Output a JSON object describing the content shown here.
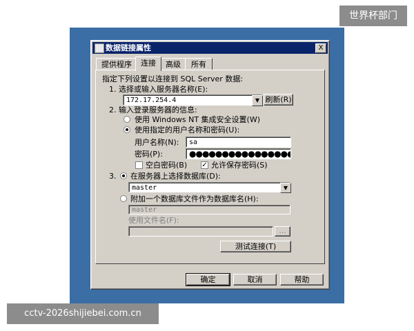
{
  "watermarks": {
    "top": "世界杯部门",
    "bottom": "cctv-2026shijiebei.com.cn"
  },
  "dialog": {
    "title": "数据链接属性",
    "close_glyph": "X",
    "tabs": [
      "提供程序",
      "连接",
      "高级",
      "所有"
    ],
    "active_tab": "连接"
  },
  "panel": {
    "intro": "指定下列设置以连接到 SQL Server 数据:",
    "step1": {
      "label": "1. 选择或输入服务器名称(E):",
      "server_value": "172.17.254.4",
      "refresh_button": "刷新(R)"
    },
    "step2": {
      "label": "2. 输入登录服务器的信息:",
      "radio_windows": "使用 Windows NT 集成安全设置(W)",
      "radio_specific": "使用指定的用户名称和密码(U):",
      "selected_auth": "specific",
      "username_label": "用户名称(N):",
      "username_value": "sa",
      "password_label": "密码(P):",
      "password_value": "●●●●●●●●●●●●●●●●●●●",
      "blank_password_label": "空白密码(B)",
      "blank_password_checked": false,
      "save_password_label": "允许保存密码(S)",
      "save_password_checked": true
    },
    "step3": {
      "prefix": "3.",
      "radio_select_db": "在服务器上选择数据库(D):",
      "db_value": "master",
      "radio_attach": "附加一个数据库文件作为数据库名(H):",
      "attach_value": "master",
      "use_filename_label": "使用文件名(F):",
      "use_filename_value": "",
      "browse_button": "...",
      "selected_db_mode": "select"
    },
    "test_button": "测试连接(T)"
  },
  "footer": {
    "ok": "确定",
    "cancel": "取消",
    "help": "帮助"
  }
}
